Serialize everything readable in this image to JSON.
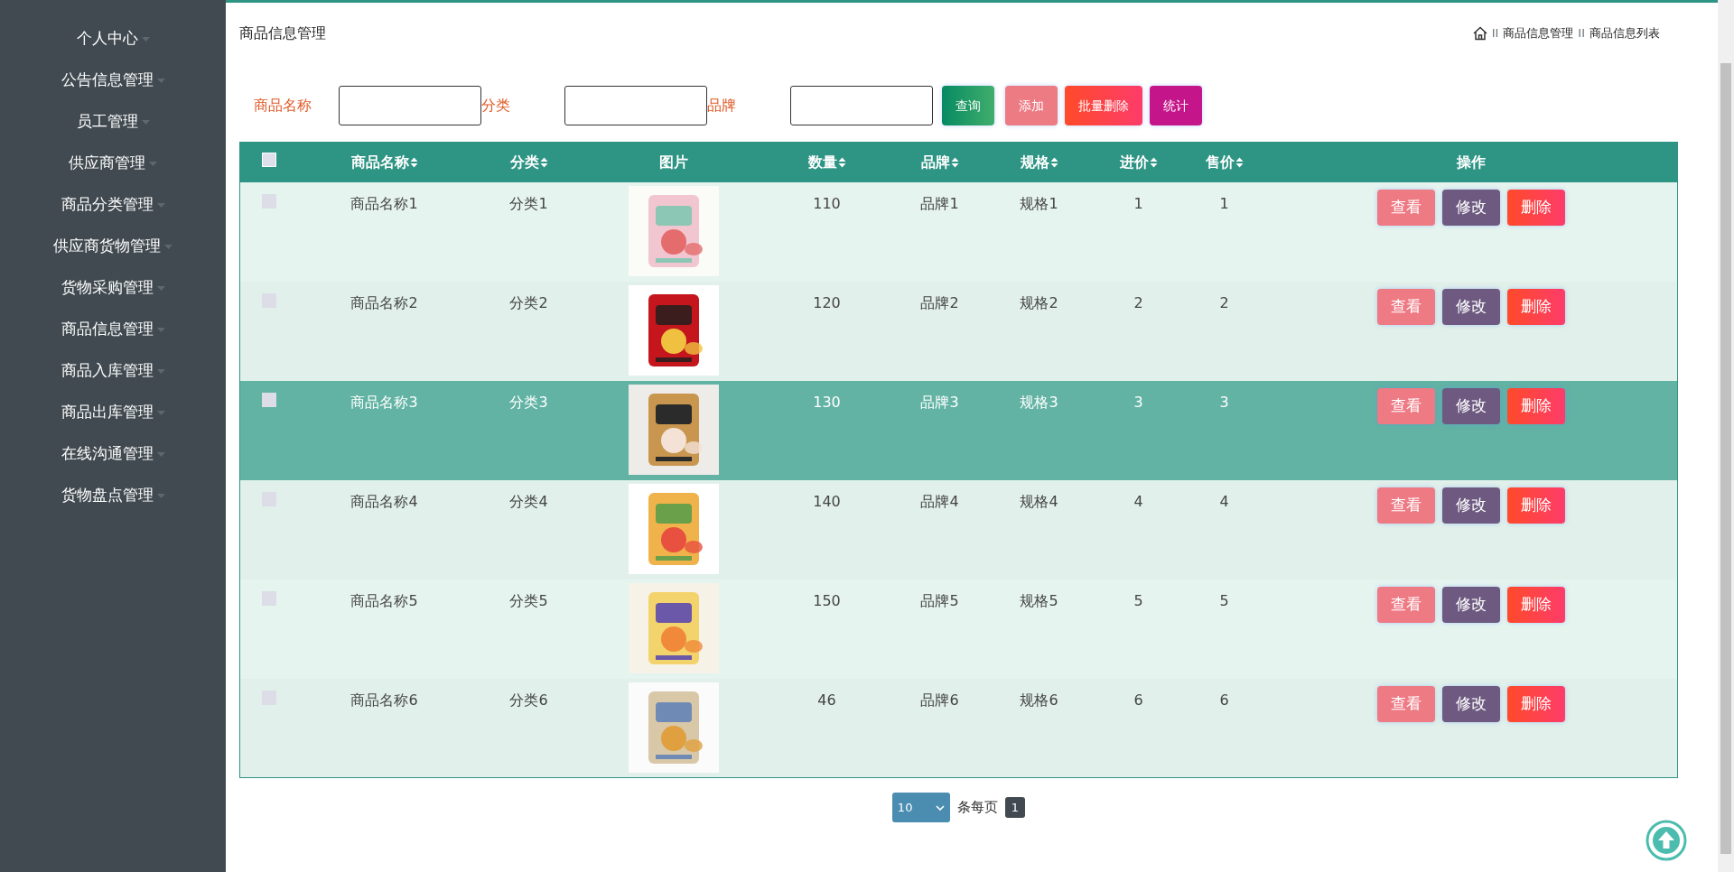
{
  "sidebar": {
    "items": [
      {
        "label": "个人中心"
      },
      {
        "label": "公告信息管理"
      },
      {
        "label": "员工管理"
      },
      {
        "label": "供应商管理"
      },
      {
        "label": "商品分类管理"
      },
      {
        "label": "供应商货物管理"
      },
      {
        "label": "货物采购管理"
      },
      {
        "label": "商品信息管理"
      },
      {
        "label": "商品入库管理"
      },
      {
        "label": "商品出库管理"
      },
      {
        "label": "在线沟通管理"
      },
      {
        "label": "货物盘点管理"
      }
    ]
  },
  "page_title": "商品信息管理",
  "breadcrumb": [
    {
      "separator": "II",
      "label": "商品信息管理"
    },
    {
      "separator": "II",
      "label": "商品信息列表"
    }
  ],
  "search": {
    "fields": [
      {
        "label": "商品名称"
      },
      {
        "label": "分类"
      },
      {
        "label": "品牌"
      }
    ],
    "buttons": [
      {
        "label": "查询",
        "kind": "query"
      },
      {
        "label": "添加",
        "kind": "add"
      },
      {
        "label": "批量删除",
        "kind": "batch-delete"
      },
      {
        "label": "统计",
        "kind": "stats"
      }
    ]
  },
  "table": {
    "all_checked": false,
    "columns": [
      {
        "label": "商品名称",
        "sortable": true
      },
      {
        "label": "分类",
        "sortable": true
      },
      {
        "label": "图片",
        "sortable": false
      },
      {
        "label": "数量",
        "sortable": true
      },
      {
        "label": "品牌",
        "sortable": true
      },
      {
        "label": "规格",
        "sortable": true
      },
      {
        "label": "进价",
        "sortable": true
      },
      {
        "label": "售价",
        "sortable": true
      },
      {
        "label": "操作",
        "sortable": false
      }
    ],
    "rows": [
      {
        "checked": false,
        "hovered": false,
        "name": "商品名称1",
        "category": "分类1",
        "image": {
          "kind": "picture"
        },
        "quantity": "110",
        "brand": "品牌1",
        "spec": "规格1",
        "cost": "1",
        "price": "1",
        "actions": [
          {
            "label": "查看",
            "kind": "view"
          },
          {
            "label": "修改",
            "kind": "edit"
          },
          {
            "label": "删除",
            "kind": "delete"
          }
        ]
      },
      {
        "checked": false,
        "hovered": false,
        "name": "商品名称2",
        "category": "分类2",
        "image": {
          "kind": "picture"
        },
        "quantity": "120",
        "brand": "品牌2",
        "spec": "规格2",
        "cost": "2",
        "price": "2",
        "actions": [
          {
            "label": "查看",
            "kind": "view"
          },
          {
            "label": "修改",
            "kind": "edit"
          },
          {
            "label": "删除",
            "kind": "delete"
          }
        ]
      },
      {
        "checked": false,
        "hovered": true,
        "name": "商品名称3",
        "category": "分类3",
        "image": {
          "kind": "picture"
        },
        "quantity": "130",
        "brand": "品牌3",
        "spec": "规格3",
        "cost": "3",
        "price": "3",
        "actions": [
          {
            "label": "查看",
            "kind": "view"
          },
          {
            "label": "修改",
            "kind": "edit"
          },
          {
            "label": "删除",
            "kind": "delete"
          }
        ]
      },
      {
        "checked": false,
        "hovered": false,
        "name": "商品名称4",
        "category": "分类4",
        "image": {
          "kind": "picture"
        },
        "quantity": "140",
        "brand": "品牌4",
        "spec": "规格4",
        "cost": "4",
        "price": "4",
        "actions": [
          {
            "label": "查看",
            "kind": "view"
          },
          {
            "label": "修改",
            "kind": "edit"
          },
          {
            "label": "删除",
            "kind": "delete"
          }
        ]
      },
      {
        "checked": false,
        "hovered": false,
        "name": "商品名称5",
        "category": "分类5",
        "image": {
          "kind": "picture"
        },
        "quantity": "150",
        "brand": "品牌5",
        "spec": "规格5",
        "cost": "5",
        "price": "5",
        "actions": [
          {
            "label": "查看",
            "kind": "view"
          },
          {
            "label": "修改",
            "kind": "edit"
          },
          {
            "label": "删除",
            "kind": "delete"
          }
        ]
      },
      {
        "checked": false,
        "hovered": false,
        "name": "商品名称6",
        "category": "分类6",
        "image": {
          "kind": "picture"
        },
        "quantity": "46",
        "brand": "品牌6",
        "spec": "规格6",
        "cost": "6",
        "price": "6",
        "actions": [
          {
            "label": "查看",
            "kind": "view"
          },
          {
            "label": "修改",
            "kind": "edit"
          },
          {
            "label": "删除",
            "kind": "delete"
          }
        ]
      }
    ]
  },
  "pagination": {
    "page_size": "10",
    "per_page_label": "条每页",
    "pages": [
      {
        "label": "1",
        "selected": true
      }
    ]
  }
}
